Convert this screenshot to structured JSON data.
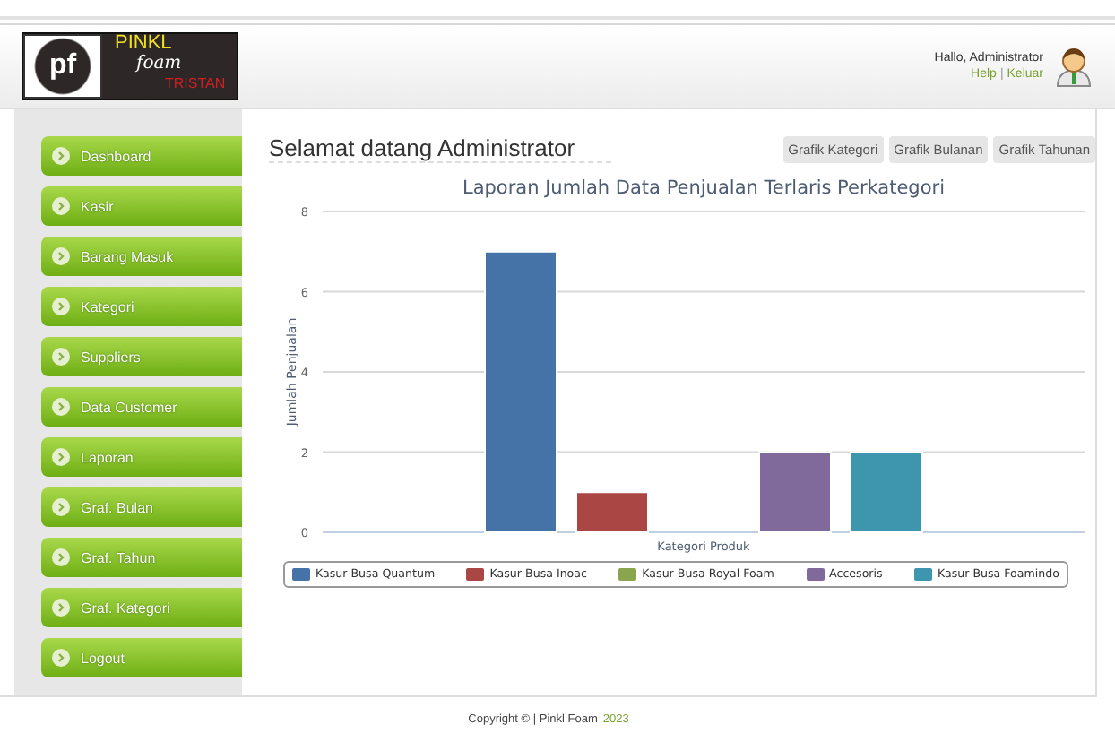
{
  "logo": {
    "mark": "pf",
    "line_1": "PINKL",
    "line_2": "foam",
    "line_3": "TRISTAN"
  },
  "user": {
    "greeting": "Hallo, Administrator",
    "links": [
      "Help",
      "Keluar"
    ],
    "separator": "|"
  },
  "sidebar": {
    "items": [
      {
        "label": "Dashboard"
      },
      {
        "label": "Kasir"
      },
      {
        "label": "Barang Masuk"
      },
      {
        "label": "Kategori"
      },
      {
        "label": "Suppliers"
      },
      {
        "label": "Data Customer"
      },
      {
        "label": "Laporan"
      },
      {
        "label": "Graf. Bulan"
      },
      {
        "label": "Graf. Tahun"
      },
      {
        "label": "Graf. Kategori"
      },
      {
        "label": "Logout"
      }
    ]
  },
  "heading": "Selamat datang Administrator",
  "buttons": [
    "Grafik Kategori",
    "Grafik Bulanan",
    "Grafik Tahunan"
  ],
  "chart_data": {
    "type": "bar",
    "title": "Laporan Jumlah Data Penjualan Terlaris Perkategori",
    "xlabel": "Kategori Produk",
    "ylabel": "Jumlah Penjualan",
    "ylim": [
      0,
      8
    ],
    "yticks": [
      0,
      2,
      4,
      6,
      8
    ],
    "grid": true,
    "legend": true,
    "series": [
      {
        "name": "Kasur Busa Quantum",
        "color": "#4572a7",
        "values": [
          7
        ]
      },
      {
        "name": "Kasur Busa Inoac",
        "color": "#aa4643",
        "values": [
          1
        ]
      },
      {
        "name": "Kasur Busa Royal Foam",
        "color": "#89a54e",
        "values": [
          0
        ]
      },
      {
        "name": "Accesoris",
        "color": "#80699b",
        "values": [
          2
        ]
      },
      {
        "name": "Kasur Busa Foamindo",
        "color": "#3d96ae",
        "values": [
          2
        ]
      }
    ]
  },
  "footer": {
    "text": "Copyright © | Pinkl Foam",
    "year": "2023"
  }
}
